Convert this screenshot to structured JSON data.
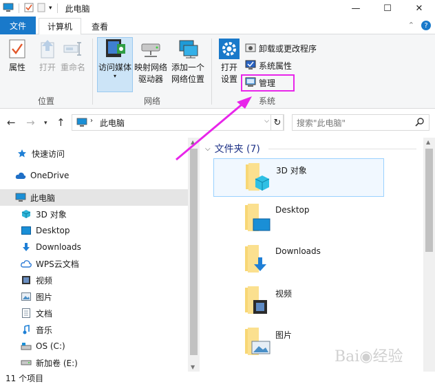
{
  "window": {
    "title": "此电脑"
  },
  "window_controls": {
    "minimize": "—",
    "maximize": "☐",
    "close": "✕"
  },
  "tabs": {
    "file": "文件",
    "computer": "计算机",
    "view": "查看"
  },
  "ribbon": {
    "location_group": {
      "label": "位置",
      "properties": "属性",
      "open": "打开",
      "rename": "重命名"
    },
    "network_group": {
      "label": "网络",
      "access_media": "访问媒体",
      "map_drive_1": "映射网络",
      "map_drive_2": "驱动器",
      "add_location_1": "添加一个",
      "add_location_2": "网络位置"
    },
    "system_group": {
      "label": "系统",
      "open_settings_1": "打开",
      "open_settings_2": "设置",
      "uninstall": "卸载或更改程序",
      "system_properties": "系统属性",
      "manage": "管理"
    }
  },
  "address": {
    "path": "此电脑",
    "search_placeholder": "搜索\"此电脑\""
  },
  "nav_pane": {
    "quick_access": "快速访问",
    "onedrive": "OneDrive",
    "this_pc": "此电脑",
    "items": [
      "3D 对象",
      "Desktop",
      "Downloads",
      "WPS云文档",
      "视频",
      "图片",
      "文档",
      "音乐",
      "OS (C:)",
      "新加卷 (E:)"
    ]
  },
  "content": {
    "group_title": "文件夹 (7)",
    "folders": [
      "3D 对象",
      "Desktop",
      "Downloads",
      "视频",
      "图片"
    ]
  },
  "status": {
    "count": "11 个项目"
  },
  "colors": {
    "accent": "#1979ca",
    "highlight": "#e825ea",
    "folder": "#f8d775"
  }
}
